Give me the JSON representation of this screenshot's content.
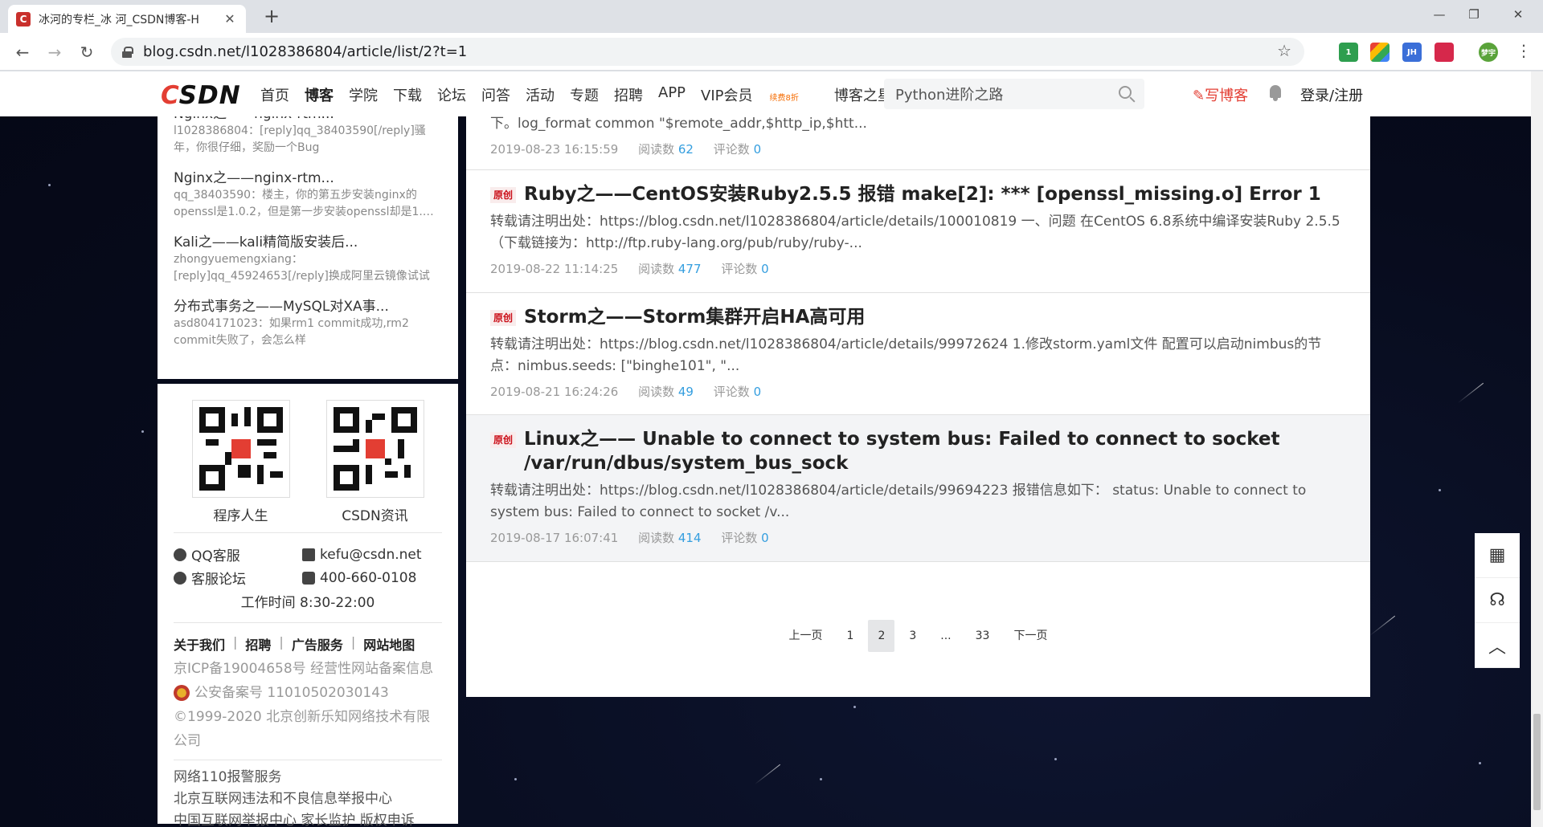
{
  "browser": {
    "tab_title": "冰河的专栏_冰 河_CSDN博客-H",
    "tab_favicon": "C",
    "url": "blog.csdn.net/l1028386804/article/list/2?t=1",
    "extensions": [
      "1",
      "",
      "JH",
      "",
      "梦宇"
    ]
  },
  "site": {
    "logo": "CSDN",
    "nav": [
      "首页",
      "博客",
      "学院",
      "下载",
      "论坛",
      "问答",
      "活动",
      "专题",
      "招聘",
      "APP",
      "VIP会员"
    ],
    "vip_promo": "续费8折",
    "star_link": "博客之星",
    "search_value": "Python进阶之路",
    "write_label": "写博客",
    "login_label": "登录/注册"
  },
  "comments": [
    {
      "title": "Nginx之——nginx-rtm...",
      "body": "l1028386804：[reply]qq_38403590[/reply]骚年，你很仔细，奖励一个Bug"
    },
    {
      "title": "Nginx之——nginx-rtm...",
      "body": "qq_38403590：楼主，你的第五步安装nginx的openssl是1.0.2，但是第一步安装openssl却是1.…"
    },
    {
      "title": "Kali之——kali精简版安装后...",
      "body": "zhongyuemengxiang：[reply]qq_45924653[/reply]换成阿里云镜像试试"
    },
    {
      "title": "分布式事务之——MySQL对XA事...",
      "body": "asd804171023：如果rm1 commit成功,rm2 commit失败了，会怎么样"
    }
  ],
  "contact": {
    "qr": [
      "程序人生",
      "CSDN资讯"
    ],
    "qq": "QQ客服",
    "email": "kefu@csdn.net",
    "forum": "客服论坛",
    "phone": "400-660-0108",
    "worktime": "工作时间 8:30-22:00",
    "links": [
      "关于我们",
      "招聘",
      "广告服务",
      "网站地图"
    ],
    "icp": "京ICP备19004658号 经营性网站备案信息",
    "police": "公安备案号 11010502030143",
    "copyright": "©1999-2020 北京创新乐知网络技术有限公司",
    "report1": "网络110报警服务",
    "report2": "北京互联网违法和不良信息举报中心",
    "report3": "中国互联网举报中心 家长监护 版权申诉"
  },
  "articles": [
    {
      "badge": "",
      "title": "",
      "desc": "下。log_format common \"$remote_addr,$http_ip,$htt...",
      "date": "2019-08-23 16:15:59",
      "reads_label": "阅读数",
      "reads": "62",
      "comments_label": "评论数",
      "comments": "0"
    },
    {
      "badge": "原创",
      "title": "Ruby之——CentOS安装Ruby2.5.5 报错 make[2]: *** [openssl_missing.o] Error 1",
      "desc": "转载请注明出处：https://blog.csdn.net/l1028386804/article/details/100010819 一、问题 在CentOS 6.8系统中编译安装Ruby 2.5.5（下载链接为：http://ftp.ruby-lang.org/pub/ruby/ruby-...",
      "date": "2019-08-22 11:14:25",
      "reads_label": "阅读数",
      "reads": "477",
      "comments_label": "评论数",
      "comments": "0"
    },
    {
      "badge": "原创",
      "title": "Storm之——Storm集群开启HA高可用",
      "desc": "转载请注明出处：https://blog.csdn.net/l1028386804/article/details/99972624 1.修改storm.yaml文件 配置可以启动nimbus的节点：nimbus.seeds: [\"binghe101\", \"...",
      "date": "2019-08-21 16:24:26",
      "reads_label": "阅读数",
      "reads": "49",
      "comments_label": "评论数",
      "comments": "0"
    },
    {
      "badge": "原创",
      "title": "Linux之—— Unable to connect to system bus: Failed to connect to socket /var/run/dbus/system_bus_sock",
      "desc": "转载请注明出处：https://blog.csdn.net/l1028386804/article/details/99694223 报错信息如下： status: Unable to connect to system bus: Failed to connect to socket /v...",
      "date": "2019-08-17 16:07:41",
      "reads_label": "阅读数",
      "reads": "414",
      "comments_label": "评论数",
      "comments": "0"
    }
  ],
  "pager": {
    "prev": "上一页",
    "p1": "1",
    "p2": "2",
    "p3": "3",
    "ellipsis": "...",
    "last": "33",
    "next": "下一页"
  }
}
